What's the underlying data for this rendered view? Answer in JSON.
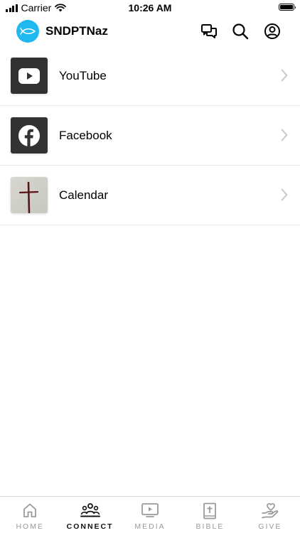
{
  "status_bar": {
    "carrier": "Carrier",
    "time": "10:26 AM"
  },
  "header": {
    "app_name": "SNDPTNaz",
    "icons": [
      "fish-logo-icon",
      "chat-icon",
      "search-icon",
      "account-icon"
    ]
  },
  "list": {
    "items": [
      {
        "label": "YouTube",
        "icon": "youtube-icon"
      },
      {
        "label": "Facebook",
        "icon": "facebook-icon"
      },
      {
        "label": "Calendar",
        "icon": "cross-icon"
      }
    ]
  },
  "tabs": [
    {
      "label": "HOME",
      "icon": "home-icon",
      "active": false
    },
    {
      "label": "CONNECT",
      "icon": "people-icon",
      "active": true
    },
    {
      "label": "MEDIA",
      "icon": "media-play-icon",
      "active": false
    },
    {
      "label": "BIBLE",
      "icon": "bible-icon",
      "active": false
    },
    {
      "label": "GIVE",
      "icon": "giving-hand-icon",
      "active": false
    }
  ],
  "colors": {
    "brand": "#1fb8f0",
    "active_tab": "#111111",
    "inactive_tab": "#9a9a9a",
    "thumb_dark": "#323232",
    "cross": "#5a1414"
  }
}
